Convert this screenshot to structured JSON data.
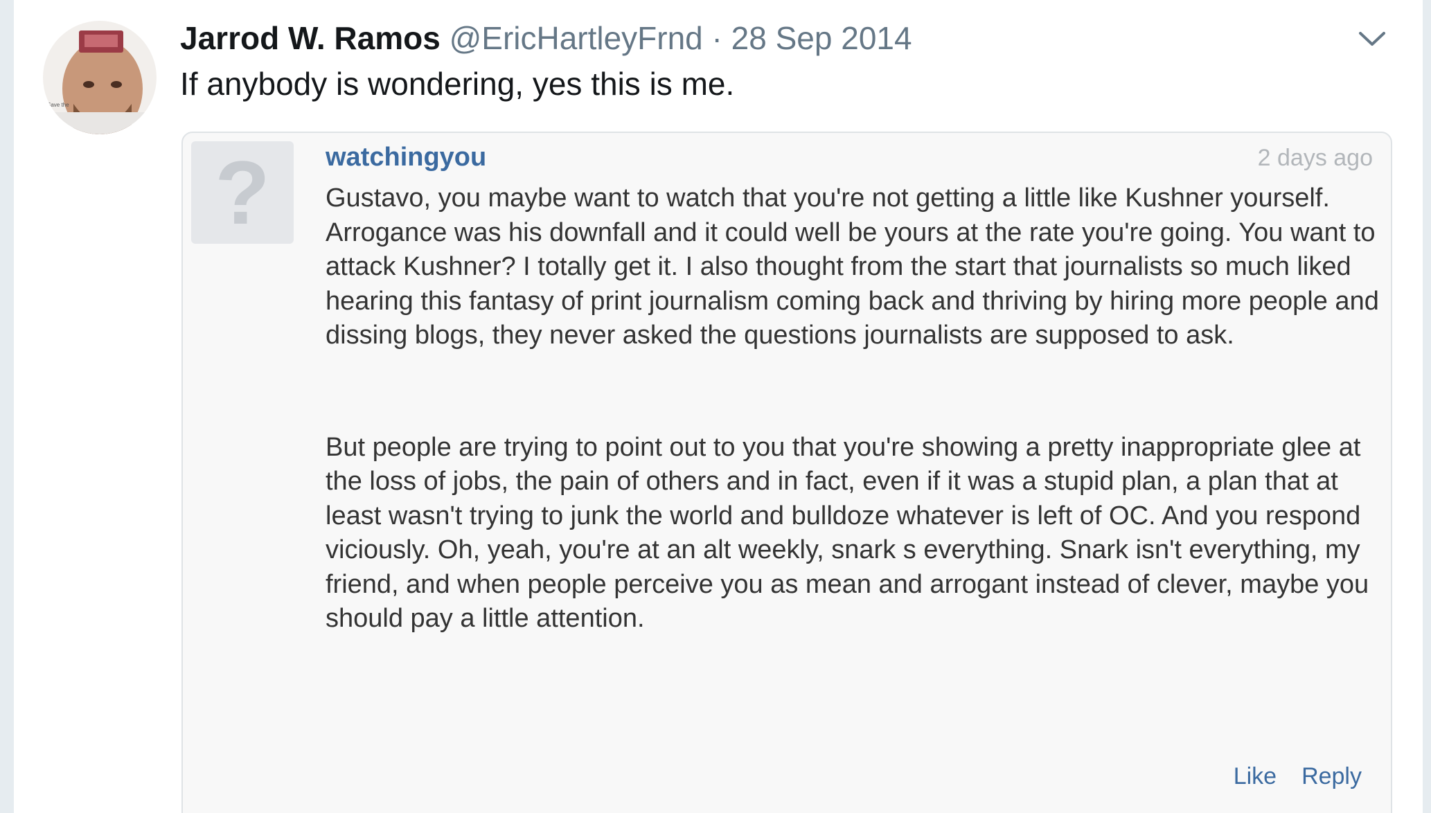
{
  "tweet": {
    "author_name": "Jarrod W. Ramos",
    "author_handle": "@EricHartleyFrnd",
    "separator": "·",
    "date": "28 Sep 2014",
    "text": "If anybody is wondering, yes this is me.",
    "menu_icon": "chevron-down-icon"
  },
  "embedded_comment": {
    "avatar_glyph": "?",
    "username": "watchingyou",
    "time_ago": "2 days ago",
    "paragraphs": [
      "Gustavo, you maybe want to watch that you're not getting a little like Kushner yourself. Arrogance was his downfall and it could well be yours at the rate you're going. You want to attack Kushner? I totally get it. I also thought from the start that journalists so much liked hearing this fantasy of print journalism coming back and thriving by hiring more people and dissing blogs, they never asked the questions journalists are supposed to ask.",
      "But people are trying to point out to you that you're showing a pretty inappropriate glee at the loss of jobs, the pain of others and in fact, even if it was a stupid plan, a plan that at least wasn't trying to junk the world and bulldoze whatever is left of OC. And you respond viciously. Oh, yeah, you're at an alt weekly, snark s everything. Snark isn't everything, my friend, and when people perceive you as mean and arrogant instead of clever, maybe you should pay a little attention."
    ],
    "actions": {
      "like_label": "Like",
      "reply_label": "Reply"
    }
  },
  "colors": {
    "link_blue": "#3b6aa0",
    "muted_gray": "#657786",
    "background_strip": "#e6ecf0"
  }
}
